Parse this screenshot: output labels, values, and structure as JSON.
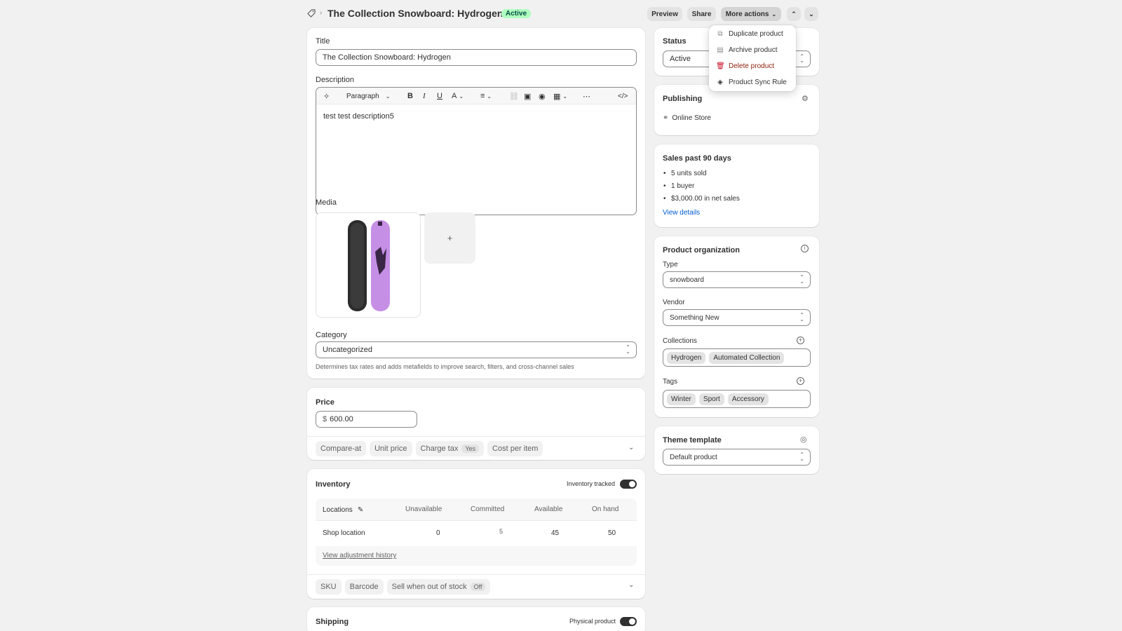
{
  "header": {
    "title": "The Collection Snowboard: Hydrogen",
    "status_badge": "Active",
    "preview_label": "Preview",
    "share_label": "Share",
    "more_actions_label": "More actions"
  },
  "more_actions_menu": {
    "items": [
      {
        "label": "Duplicate product",
        "icon": "copy-icon"
      },
      {
        "label": "Archive product",
        "icon": "archive-icon"
      },
      {
        "label": "Delete product",
        "icon": "trash-icon",
        "color": "#8e1f0b"
      },
      {
        "label": "Product Sync Rule",
        "icon": "app-icon"
      }
    ]
  },
  "product": {
    "title_label": "Title",
    "title_value": "The Collection Snowboard: Hydrogen",
    "description_label": "Description",
    "description_value": "test test description5",
    "toolbar_paragraph": "Paragraph",
    "media_label": "Media",
    "media_add": "+",
    "category_label": "Category",
    "category_value": "Uncategorized",
    "category_help": "Determines tax rates and adds metafields to improve search, filters, and cross-channel sales"
  },
  "price": {
    "label": "Price",
    "currency": "$",
    "value": "600.00",
    "chips": {
      "compare_at": "Compare-at",
      "unit_price": "Unit price",
      "charge_tax": "Charge tax",
      "charge_tax_value": "Yes",
      "cost_per_item": "Cost per item"
    }
  },
  "inventory": {
    "label": "Inventory",
    "tracked_label": "Inventory tracked",
    "columns": {
      "locations": "Locations",
      "unavailable": "Unavailable",
      "committed": "Committed",
      "available": "Available",
      "on_hand": "On hand"
    },
    "row": {
      "location": "Shop location",
      "unavailable": "0",
      "committed": "5",
      "available": "45",
      "on_hand": "50"
    },
    "history_link": "View adjustment history",
    "chips": {
      "sku": "SKU",
      "barcode": "Barcode",
      "sell_oos": "Sell when out of stock",
      "sell_oos_value": "Off"
    }
  },
  "shipping": {
    "label": "Shipping",
    "physical_label": "Physical product"
  },
  "status_card": {
    "label": "Status",
    "value": "Active"
  },
  "publishing": {
    "label": "Publishing",
    "channel": "Online Store"
  },
  "sales": {
    "label": "Sales past 90 days",
    "items": [
      "5 units sold",
      "1 buyer",
      "$3,000.00 in net sales"
    ],
    "link": "View details"
  },
  "organization": {
    "label": "Product organization",
    "type_label": "Type",
    "type_value": "snowboard",
    "vendor_label": "Vendor",
    "vendor_value": "Something New",
    "collections_label": "Collections",
    "collections": [
      "Hydrogen",
      "Automated Collection"
    ],
    "tags_label": "Tags",
    "tags": [
      "Winter",
      "Sport",
      "Accessory"
    ]
  },
  "theme": {
    "label": "Theme template",
    "value": "Default product"
  },
  "colors": {
    "accent_link": "#005bd3",
    "badge_bg": "#affebf",
    "badge_text": "#014b40",
    "danger": "#8e1f0b"
  }
}
